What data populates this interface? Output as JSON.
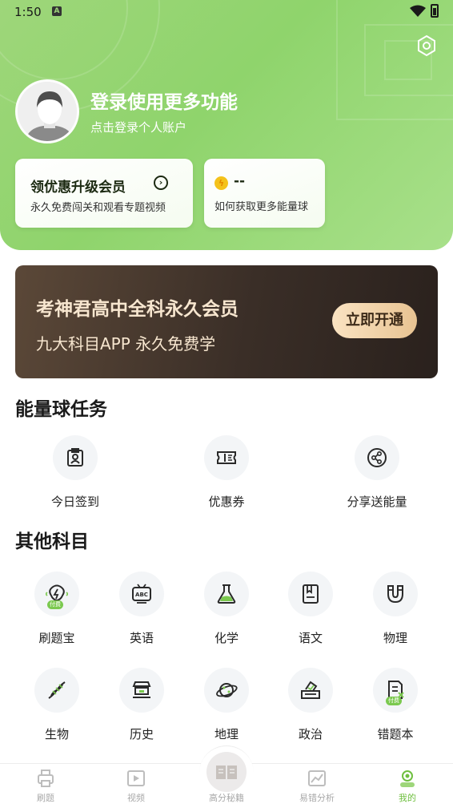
{
  "status_bar": {
    "time": "1:50"
  },
  "profile": {
    "title": "登录使用更多功能",
    "subtitle": "点击登录个人账户"
  },
  "vip_card": {
    "title": "领优惠升级会员",
    "subtitle": "永久免费闯关和观看专题视频"
  },
  "energy_card": {
    "value": "--",
    "subtitle": "如何获取更多能量球"
  },
  "banner": {
    "title": "考神君高中全科永久会员",
    "subtitle": "九大科目APP 永久免费学",
    "button": "立即开通"
  },
  "energy_tasks": {
    "title": "能量球任务",
    "items": [
      {
        "label": "今日签到",
        "icon": "calendar-check-icon"
      },
      {
        "label": "优惠券",
        "icon": "coupon-icon"
      },
      {
        "label": "分享送能量",
        "icon": "share-icon"
      }
    ]
  },
  "other_subjects": {
    "title": "其他科目",
    "badge": "付费",
    "items": [
      {
        "label": "刷题宝",
        "icon": "brain-code-icon"
      },
      {
        "label": "英语",
        "icon": "abc-tv-icon"
      },
      {
        "label": "化学",
        "icon": "flask-icon"
      },
      {
        "label": "语文",
        "icon": "book-icon"
      },
      {
        "label": "物理",
        "icon": "magnet-icon"
      },
      {
        "label": "生物",
        "icon": "dna-icon"
      },
      {
        "label": "历史",
        "icon": "temple-icon"
      },
      {
        "label": "地理",
        "icon": "planet-icon"
      },
      {
        "label": "政治",
        "icon": "ballot-box-icon"
      },
      {
        "label": "错题本",
        "icon": "wrong-notebook-icon"
      }
    ]
  },
  "tabbar": {
    "tabs": [
      {
        "label": "刷题",
        "icon": "printer-icon"
      },
      {
        "label": "视频",
        "icon": "video-icon"
      },
      {
        "label": "高分秘籍",
        "icon": "open-book-icon"
      },
      {
        "label": "易错分析",
        "icon": "chart-icon"
      },
      {
        "label": "我的",
        "icon": "profile-icon",
        "active": true
      }
    ]
  },
  "colors": {
    "primary_green": "#8fd46c",
    "active_tab": "#6fbf3f",
    "banner_dark": "#3a2e27",
    "banner_gold": "#e8c392"
  }
}
